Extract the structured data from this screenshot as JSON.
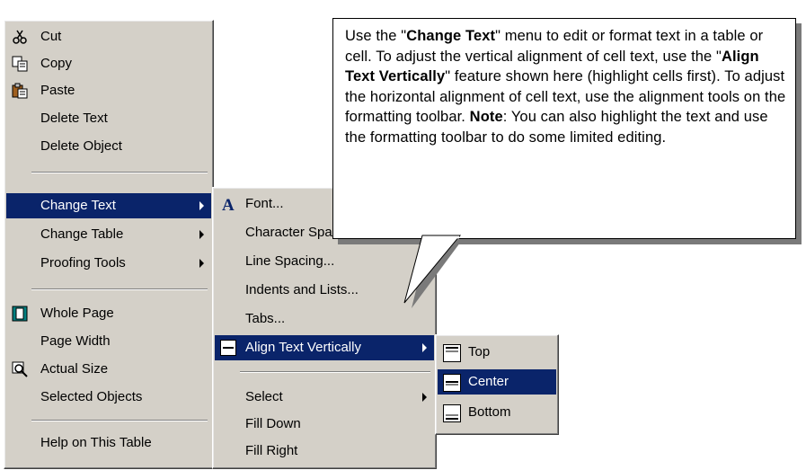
{
  "context_menu": {
    "items": [
      {
        "label": "Cut",
        "icon": "scissors-icon"
      },
      {
        "label": "Copy",
        "icon": "copy-icon"
      },
      {
        "label": "Paste",
        "icon": "paste-icon"
      },
      {
        "label": "Delete Text"
      },
      {
        "label": "Delete Object"
      },
      {
        "label": "Change Text",
        "selected": true,
        "submenu": true
      },
      {
        "label": "Change Table",
        "submenu": true
      },
      {
        "label": "Proofing Tools",
        "submenu": true
      },
      {
        "label": "Whole Page",
        "icon": "whole-page-icon"
      },
      {
        "label": "Page Width"
      },
      {
        "label": "Actual Size",
        "icon": "zoom-icon"
      },
      {
        "label": "Selected Objects"
      },
      {
        "label": "Help on This Table"
      }
    ]
  },
  "change_text_menu": {
    "items": [
      {
        "label": "Font...",
        "icon": "font-a-icon"
      },
      {
        "label": "Character Spacing..."
      },
      {
        "label": "Line Spacing..."
      },
      {
        "label": "Indents and Lists..."
      },
      {
        "label": "Tabs..."
      },
      {
        "label": "Align Text Vertically",
        "submenu": true,
        "icon": "align-vertical-icon"
      },
      {
        "label": "Select",
        "submenu": true
      },
      {
        "label": "Fill Down"
      },
      {
        "label": "Fill Right"
      }
    ]
  },
  "align_menu": {
    "items": [
      {
        "label": "Top"
      },
      {
        "label": "Center",
        "selected": true
      },
      {
        "label": "Bottom"
      }
    ]
  },
  "callout": {
    "t1": "Use the \"",
    "b1": "Change Text",
    "t2": "\" menu to edit or format text in a table or cell. To adjust the vertical alignment of cell text, use the \"",
    "b2": "Align Text Vertically",
    "t3": "\" feature shown here (highlight cells first).  To adjust the horizontal alignment of cell text, use the alignment tools on the formatting toolbar. ",
    "b3": "Note",
    "t4": ": You can also highlight the text and use the formatting toolbar to do some limited editing."
  },
  "colors": {
    "menu_bg": "#d4d0c8",
    "highlight": "#0a246a",
    "highlight_text": "#ffffff"
  }
}
